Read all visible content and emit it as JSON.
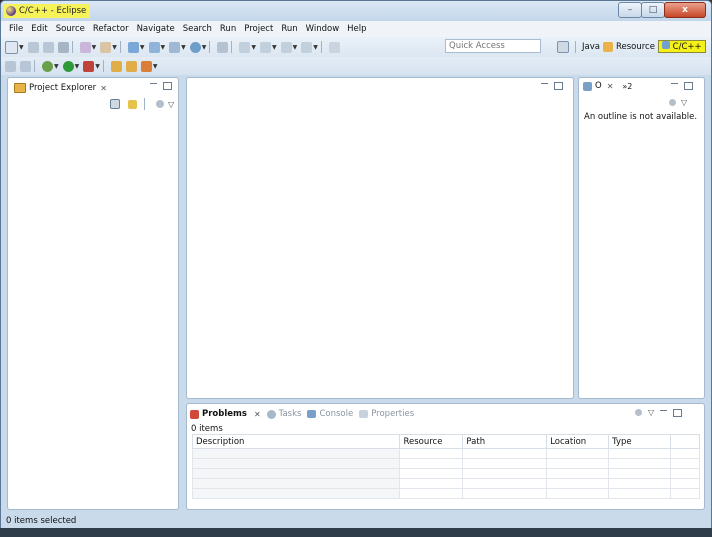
{
  "window": {
    "title": "C/C++ - Eclipse",
    "controls": {
      "minimize": "–",
      "maximize": "□",
      "close": "x"
    }
  },
  "menu": [
    "File",
    "Edit",
    "Source",
    "Refactor",
    "Navigate",
    "Search",
    "Run",
    "Project",
    "Run",
    "Window",
    "Help"
  ],
  "toolbar": {
    "quick_access_placeholder": "Quick Access",
    "perspectives": {
      "java": "Java",
      "resource": "Resource",
      "cpp": "C/C++"
    }
  },
  "project_explorer": {
    "tab_label": "Project Explorer"
  },
  "outline": {
    "tab_label": "O",
    "overflow_label": "»2",
    "message": "An outline is not available."
  },
  "bottom_panel": {
    "tabs": {
      "problems": "Problems",
      "tasks": "Tasks",
      "console": "Console",
      "properties": "Properties"
    },
    "items_count": "0 items",
    "columns": [
      "Description",
      "Resource",
      "Path",
      "Location",
      "Type"
    ]
  },
  "status_bar": {
    "text": "0 items selected"
  },
  "colors": {
    "highlight": "#f6f25a",
    "window_bg": "#c9daea",
    "accent": "#5a7896"
  }
}
